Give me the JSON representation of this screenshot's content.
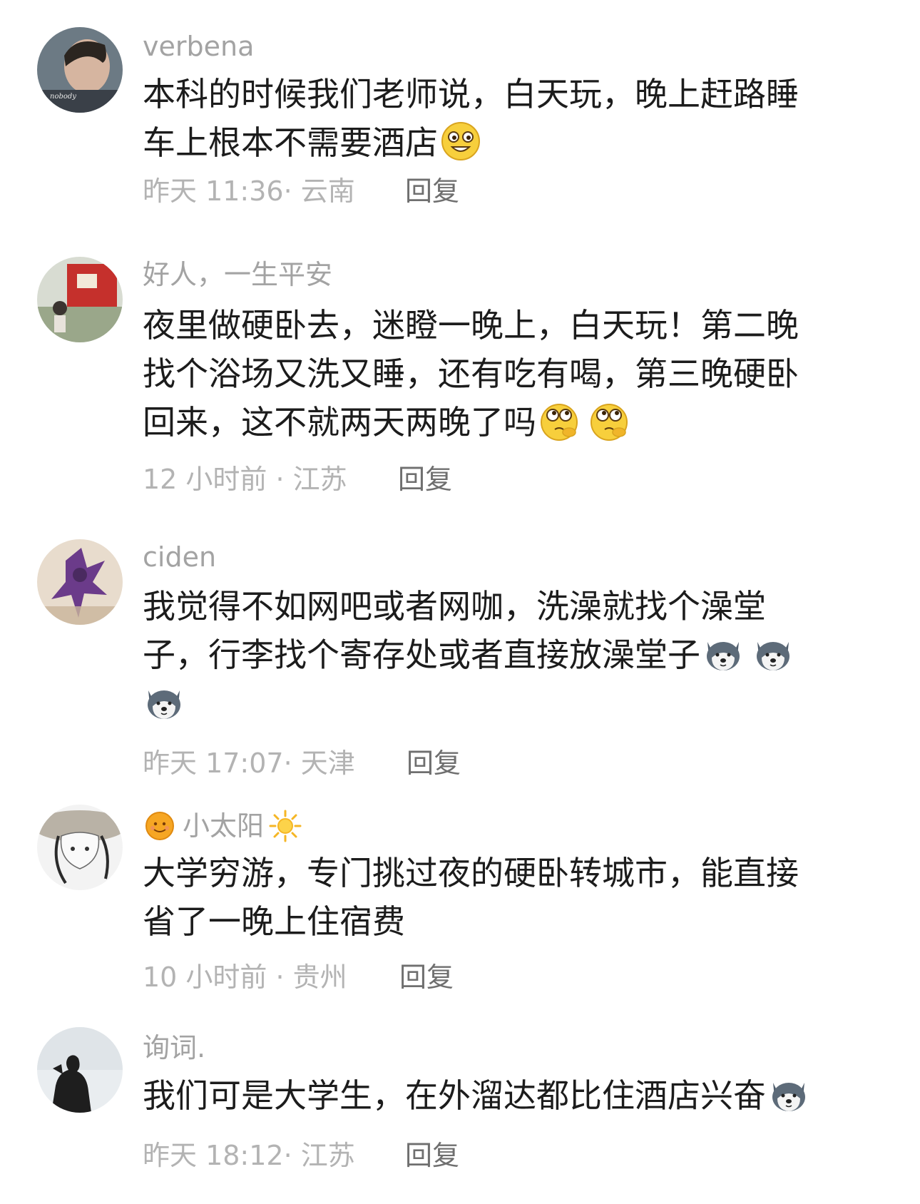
{
  "reply_label": "回复",
  "comments": [
    {
      "username": "verbena",
      "lines": [
        "本科的时候我们老师说，白天玩，晚上赶路睡",
        "车上根本不需要酒店"
      ],
      "emojis_after_last_line": [
        "grin-emoji"
      ],
      "meta": "昨天 11:36· 云南"
    },
    {
      "username": "好人，一生平安",
      "lines": [
        "夜里做硬卧去，迷瞪一晚上，白天玩！第二晚",
        "找个浴场又洗又睡，还有吃有喝，第三晚硬卧",
        "回来，这不就两天两晚了吗"
      ],
      "emojis_after_last_line": [
        "thinking-emoji",
        "thinking-emoji"
      ],
      "meta": "12 小时前 · 江苏"
    },
    {
      "username": "ciden",
      "lines": [
        "我觉得不如网吧或者网咖，洗澡就找个澡堂",
        "子，行李找个寄存处或者直接放澡堂子"
      ],
      "emojis_line2": [
        "husky-emoji",
        "husky-emoji"
      ],
      "emojis_line3": [
        "husky-emoji"
      ],
      "meta": "昨天 17:07· 天津"
    },
    {
      "username": "小太阳",
      "lines": [
        "大学穷游，专门挑过夜的硬卧转城市，能直接",
        "省了一晚上住宿费"
      ],
      "meta": "10 小时前 · 贵州"
    },
    {
      "username": "询词.",
      "lines": [
        "我们可是大学生，在外溜达都比住酒店兴奋"
      ],
      "emojis_after_last_line": [
        "husky-emoji"
      ],
      "meta": "昨天 18:12· 江苏"
    }
  ]
}
